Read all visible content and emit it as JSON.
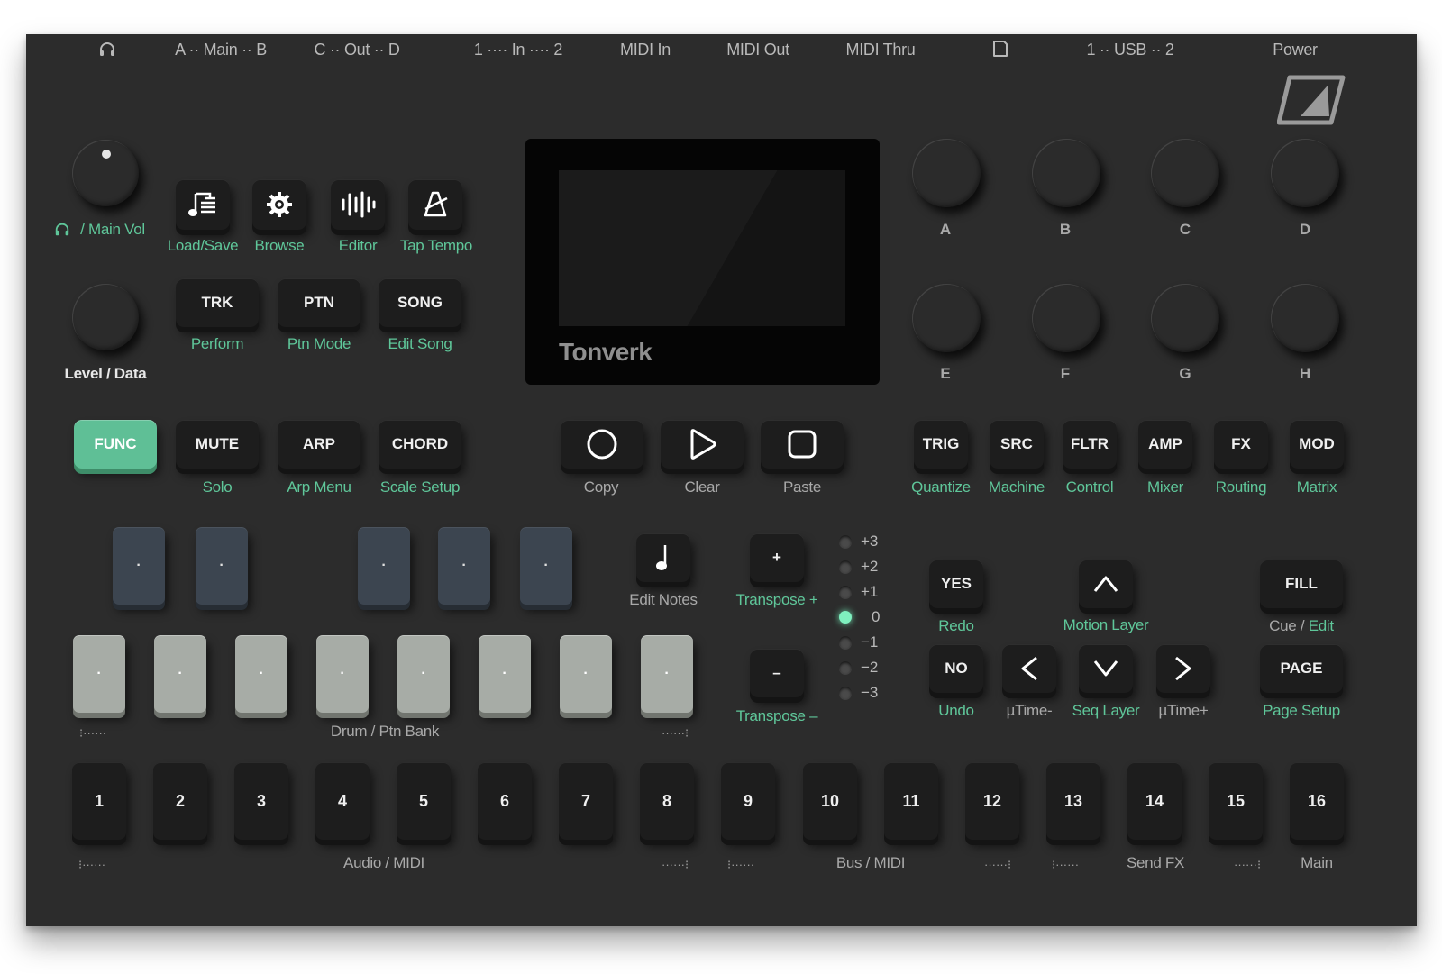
{
  "ports": [
    "A ·· Main ·· B",
    "C ·· Out ·· D",
    "1 ···· In ···· 2",
    "MIDI In",
    "MIDI Out",
    "MIDI Thru",
    "1 ·· USB ·· 2",
    "Power"
  ],
  "port_icons": [
    "headphones-icon",
    "sd-card-icon"
  ],
  "brand_logo": "tonverk-logo-icon",
  "vol_knob_label": "/ Main Vol",
  "data_knob_label": "Level / Data",
  "top_buttons": [
    {
      "icon": "music-file-icon",
      "label": "Load/Save"
    },
    {
      "icon": "gear-icon",
      "label": "Browse"
    },
    {
      "icon": "waveform-icon",
      "label": "Editor"
    },
    {
      "icon": "metronome-icon",
      "label": "Tap Tempo"
    }
  ],
  "mode_buttons": [
    {
      "label": "TRK",
      "sub": "Perform"
    },
    {
      "label": "PTN",
      "sub": "Ptn Mode"
    },
    {
      "label": "SONG",
      "sub": "Edit Song"
    }
  ],
  "screen_brand": "Tonverk",
  "knobs": [
    "A",
    "B",
    "C",
    "D",
    "E",
    "F",
    "G",
    "H"
  ],
  "func": "FUNC",
  "row_buttons": [
    {
      "label": "MUTE",
      "sub": "Solo"
    },
    {
      "label": "ARP",
      "sub": "Arp Menu"
    },
    {
      "label": "CHORD",
      "sub": "Scale Setup"
    }
  ],
  "transport": [
    {
      "icon": "record-icon",
      "sub": "Copy"
    },
    {
      "icon": "play-icon",
      "sub": "Clear"
    },
    {
      "icon": "stop-icon",
      "sub": "Paste"
    }
  ],
  "page_buttons": [
    {
      "label": "TRIG",
      "sub": "Quantize"
    },
    {
      "label": "SRC",
      "sub": "Machine"
    },
    {
      "label": "FLTR",
      "sub": "Control"
    },
    {
      "label": "AMP",
      "sub": "Mixer"
    },
    {
      "label": "FX",
      "sub": "Routing"
    },
    {
      "label": "MOD",
      "sub": "Matrix"
    }
  ],
  "edit_notes": "Edit Notes",
  "transpose_plus": {
    "symbol": "+",
    "label": "Transpose +"
  },
  "transpose_minus": {
    "symbol": "–",
    "label": "Transpose –"
  },
  "octave_leds": [
    "+3",
    "+2",
    "+1",
    "0",
    "−1",
    "−2",
    "−3"
  ],
  "octave_active": "0",
  "yes": {
    "label": "YES",
    "sub": "Redo"
  },
  "no": {
    "label": "NO",
    "sub": "Undo"
  },
  "motion_layer": "Motion Layer",
  "utime_minus": "µTime-",
  "seq_layer": "Seq Layer",
  "utime_plus": "µTime+",
  "fill": {
    "label": "FILL",
    "sub_a": "Cue / ",
    "sub_b": "Edit"
  },
  "page": {
    "label": "PAGE",
    "sub": "Page Setup"
  },
  "drum_bank_label": "Drum / Ptn Bank",
  "pad_dot": "·",
  "steps": [
    "1",
    "2",
    "3",
    "4",
    "5",
    "6",
    "7",
    "8",
    "9",
    "10",
    "11",
    "12",
    "13",
    "14",
    "15",
    "16"
  ],
  "step_groups": [
    "Audio / MIDI",
    "Bus / MIDI",
    "Send FX",
    "Main"
  ],
  "bracket_start": "⁝······",
  "bracket_end": "······⁝",
  "colors": {
    "panel": "#2c2c2c",
    "accent": "#5fc79a",
    "button": "#1d1d1d",
    "blue_pad": "#3c4550",
    "grey_pad": "#a7aca6",
    "led_on": "#7ff0bf"
  }
}
